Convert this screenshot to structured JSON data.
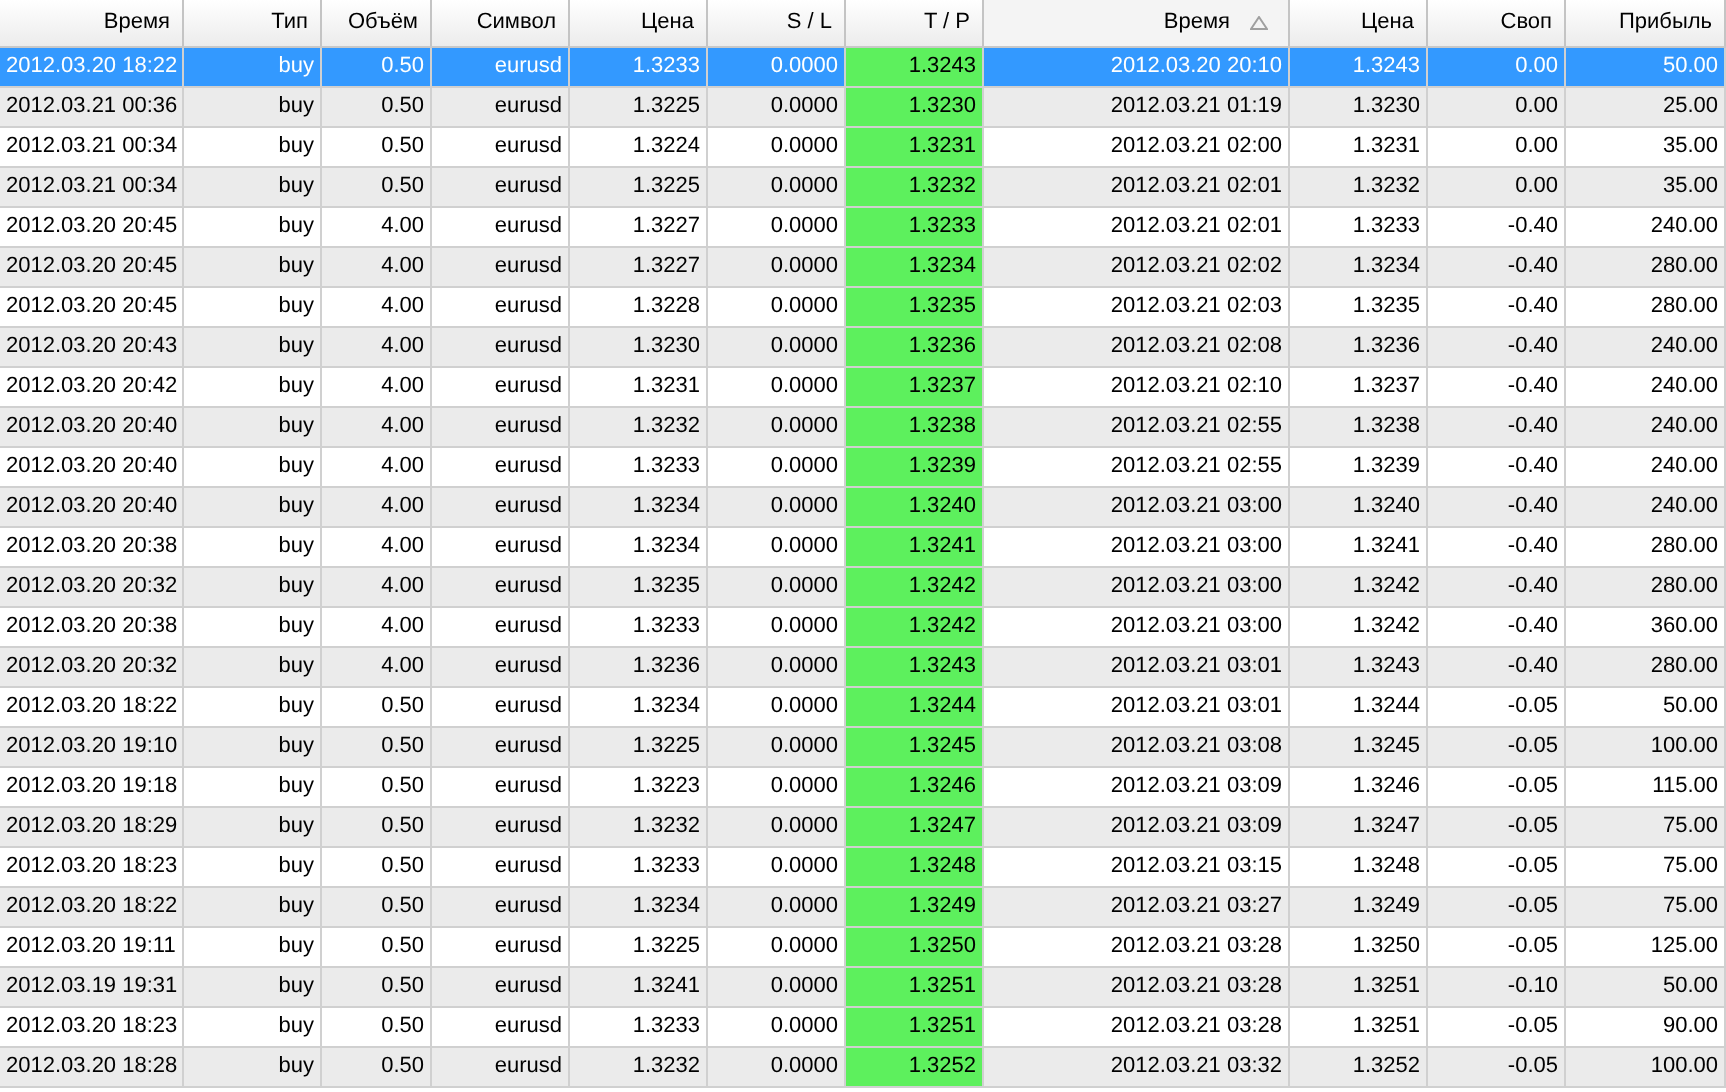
{
  "table": {
    "columns": [
      {
        "label": "Время",
        "sorted": false
      },
      {
        "label": "Тип",
        "sorted": false
      },
      {
        "label": "Объём",
        "sorted": false
      },
      {
        "label": "Символ",
        "sorted": false
      },
      {
        "label": "Цена",
        "sorted": false
      },
      {
        "label": "S / L",
        "sorted": false
      },
      {
        "label": "T / P",
        "sorted": false
      },
      {
        "label": "Время",
        "sorted": true
      },
      {
        "label": "Цена",
        "sorted": false
      },
      {
        "label": "Своп",
        "sorted": false
      },
      {
        "label": "Прибыль",
        "sorted": false
      }
    ],
    "rows": [
      {
        "selected": true,
        "cells": [
          "2012.03.20 18:22",
          "buy",
          "0.50",
          "eurusd",
          "1.3233",
          "0.0000",
          "1.3243",
          "2012.03.20 20:10",
          "1.3243",
          "0.00",
          "50.00"
        ]
      },
      {
        "selected": false,
        "cells": [
          "2012.03.21 00:36",
          "buy",
          "0.50",
          "eurusd",
          "1.3225",
          "0.0000",
          "1.3230",
          "2012.03.21 01:19",
          "1.3230",
          "0.00",
          "25.00"
        ]
      },
      {
        "selected": false,
        "cells": [
          "2012.03.21 00:34",
          "buy",
          "0.50",
          "eurusd",
          "1.3224",
          "0.0000",
          "1.3231",
          "2012.03.21 02:00",
          "1.3231",
          "0.00",
          "35.00"
        ]
      },
      {
        "selected": false,
        "cells": [
          "2012.03.21 00:34",
          "buy",
          "0.50",
          "eurusd",
          "1.3225",
          "0.0000",
          "1.3232",
          "2012.03.21 02:01",
          "1.3232",
          "0.00",
          "35.00"
        ]
      },
      {
        "selected": false,
        "cells": [
          "2012.03.20 20:45",
          "buy",
          "4.00",
          "eurusd",
          "1.3227",
          "0.0000",
          "1.3233",
          "2012.03.21 02:01",
          "1.3233",
          "-0.40",
          "240.00"
        ]
      },
      {
        "selected": false,
        "cells": [
          "2012.03.20 20:45",
          "buy",
          "4.00",
          "eurusd",
          "1.3227",
          "0.0000",
          "1.3234",
          "2012.03.21 02:02",
          "1.3234",
          "-0.40",
          "280.00"
        ]
      },
      {
        "selected": false,
        "cells": [
          "2012.03.20 20:45",
          "buy",
          "4.00",
          "eurusd",
          "1.3228",
          "0.0000",
          "1.3235",
          "2012.03.21 02:03",
          "1.3235",
          "-0.40",
          "280.00"
        ]
      },
      {
        "selected": false,
        "cells": [
          "2012.03.20 20:43",
          "buy",
          "4.00",
          "eurusd",
          "1.3230",
          "0.0000",
          "1.3236",
          "2012.03.21 02:08",
          "1.3236",
          "-0.40",
          "240.00"
        ]
      },
      {
        "selected": false,
        "cells": [
          "2012.03.20 20:42",
          "buy",
          "4.00",
          "eurusd",
          "1.3231",
          "0.0000",
          "1.3237",
          "2012.03.21 02:10",
          "1.3237",
          "-0.40",
          "240.00"
        ]
      },
      {
        "selected": false,
        "cells": [
          "2012.03.20 20:40",
          "buy",
          "4.00",
          "eurusd",
          "1.3232",
          "0.0000",
          "1.3238",
          "2012.03.21 02:55",
          "1.3238",
          "-0.40",
          "240.00"
        ]
      },
      {
        "selected": false,
        "cells": [
          "2012.03.20 20:40",
          "buy",
          "4.00",
          "eurusd",
          "1.3233",
          "0.0000",
          "1.3239",
          "2012.03.21 02:55",
          "1.3239",
          "-0.40",
          "240.00"
        ]
      },
      {
        "selected": false,
        "cells": [
          "2012.03.20 20:40",
          "buy",
          "4.00",
          "eurusd",
          "1.3234",
          "0.0000",
          "1.3240",
          "2012.03.21 03:00",
          "1.3240",
          "-0.40",
          "240.00"
        ]
      },
      {
        "selected": false,
        "cells": [
          "2012.03.20 20:38",
          "buy",
          "4.00",
          "eurusd",
          "1.3234",
          "0.0000",
          "1.3241",
          "2012.03.21 03:00",
          "1.3241",
          "-0.40",
          "280.00"
        ]
      },
      {
        "selected": false,
        "cells": [
          "2012.03.20 20:32",
          "buy",
          "4.00",
          "eurusd",
          "1.3235",
          "0.0000",
          "1.3242",
          "2012.03.21 03:00",
          "1.3242",
          "-0.40",
          "280.00"
        ]
      },
      {
        "selected": false,
        "cells": [
          "2012.03.20 20:38",
          "buy",
          "4.00",
          "eurusd",
          "1.3233",
          "0.0000",
          "1.3242",
          "2012.03.21 03:00",
          "1.3242",
          "-0.40",
          "360.00"
        ]
      },
      {
        "selected": false,
        "cells": [
          "2012.03.20 20:32",
          "buy",
          "4.00",
          "eurusd",
          "1.3236",
          "0.0000",
          "1.3243",
          "2012.03.21 03:01",
          "1.3243",
          "-0.40",
          "280.00"
        ]
      },
      {
        "selected": false,
        "cells": [
          "2012.03.20 18:22",
          "buy",
          "0.50",
          "eurusd",
          "1.3234",
          "0.0000",
          "1.3244",
          "2012.03.21 03:01",
          "1.3244",
          "-0.05",
          "50.00"
        ]
      },
      {
        "selected": false,
        "cells": [
          "2012.03.20 19:10",
          "buy",
          "0.50",
          "eurusd",
          "1.3225",
          "0.0000",
          "1.3245",
          "2012.03.21 03:08",
          "1.3245",
          "-0.05",
          "100.00"
        ]
      },
      {
        "selected": false,
        "cells": [
          "2012.03.20 19:18",
          "buy",
          "0.50",
          "eurusd",
          "1.3223",
          "0.0000",
          "1.3246",
          "2012.03.21 03:09",
          "1.3246",
          "-0.05",
          "115.00"
        ]
      },
      {
        "selected": false,
        "cells": [
          "2012.03.20 18:29",
          "buy",
          "0.50",
          "eurusd",
          "1.3232",
          "0.0000",
          "1.3247",
          "2012.03.21 03:09",
          "1.3247",
          "-0.05",
          "75.00"
        ]
      },
      {
        "selected": false,
        "cells": [
          "2012.03.20 18:23",
          "buy",
          "0.50",
          "eurusd",
          "1.3233",
          "0.0000",
          "1.3248",
          "2012.03.21 03:15",
          "1.3248",
          "-0.05",
          "75.00"
        ]
      },
      {
        "selected": false,
        "cells": [
          "2012.03.20 18:22",
          "buy",
          "0.50",
          "eurusd",
          "1.3234",
          "0.0000",
          "1.3249",
          "2012.03.21 03:27",
          "1.3249",
          "-0.05",
          "75.00"
        ]
      },
      {
        "selected": false,
        "cells": [
          "2012.03.20 19:11",
          "buy",
          "0.50",
          "eurusd",
          "1.3225",
          "0.0000",
          "1.3250",
          "2012.03.21 03:28",
          "1.3250",
          "-0.05",
          "125.00"
        ]
      },
      {
        "selected": false,
        "cells": [
          "2012.03.19 19:31",
          "buy",
          "0.50",
          "eurusd",
          "1.3241",
          "0.0000",
          "1.3251",
          "2012.03.21 03:28",
          "1.3251",
          "-0.10",
          "50.00"
        ]
      },
      {
        "selected": false,
        "cells": [
          "2012.03.20 18:23",
          "buy",
          "0.50",
          "eurusd",
          "1.3233",
          "0.0000",
          "1.3251",
          "2012.03.21 03:28",
          "1.3251",
          "-0.05",
          "90.00"
        ]
      },
      {
        "selected": false,
        "cells": [
          "2012.03.20 18:28",
          "buy",
          "0.50",
          "eurusd",
          "1.3232",
          "0.0000",
          "1.3252",
          "2012.03.21 03:32",
          "1.3252",
          "-0.05",
          "100.00"
        ]
      }
    ]
  }
}
